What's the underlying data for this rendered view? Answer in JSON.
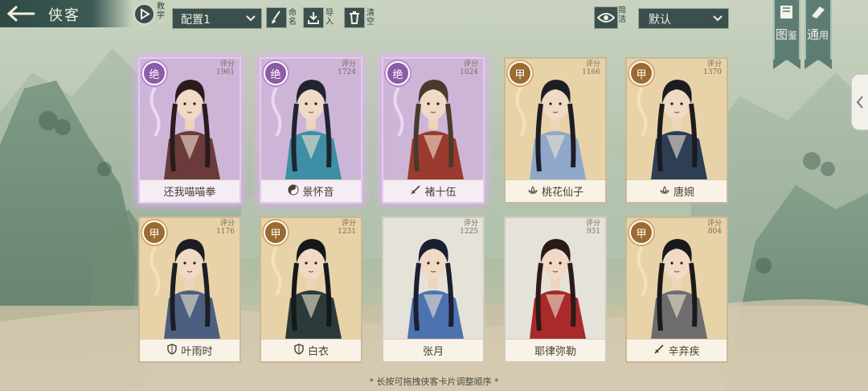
{
  "header": {
    "title": "侠客",
    "tutorial_label": "教学",
    "config_value": "配置1",
    "rename_label": "命名",
    "import_label": "导入",
    "clear_label": "清空",
    "simple_label": "简洁",
    "sort_value": "默认"
  },
  "right_banners": [
    {
      "label_big": "图",
      "label_small": "鉴"
    },
    {
      "label_big": "通",
      "label_small": "用"
    }
  ],
  "score_label": "评分",
  "cards": [
    {
      "grade": "绝",
      "score": "1961",
      "name": "还我喵喵拳",
      "tier": "jue",
      "name_icon": "",
      "palette": [
        "#cdb5d8",
        "#6b3b3b",
        "#2a1c1c"
      ]
    },
    {
      "grade": "绝",
      "score": "1724",
      "name": "景怀音",
      "tier": "jue",
      "name_icon": "yin-yang-icon",
      "palette": [
        "#cdb5d8",
        "#3e8fa5",
        "#1e2530"
      ]
    },
    {
      "grade": "绝",
      "score": "1024",
      "name": "褚十伍",
      "tier": "jue",
      "name_icon": "sword-icon",
      "palette": [
        "#cdb5d8",
        "#9b3a2e",
        "#4a3a2a"
      ]
    },
    {
      "grade": "甲",
      "score": "1166",
      "name": "桃花仙子",
      "tier": "jia",
      "name_icon": "lotus-icon",
      "palette": [
        "#e8d3a8",
        "#8fa8c9",
        "#1d1d24"
      ]
    },
    {
      "grade": "甲",
      "score": "1370",
      "name": "唐婉",
      "tier": "jia",
      "name_icon": "lotus-icon",
      "palette": [
        "#e8d3a8",
        "#2d3e55",
        "#1b1b20"
      ]
    },
    {
      "grade": "甲",
      "score": "1176",
      "name": "叶雨时",
      "tier": "jia",
      "name_icon": "shield-icon",
      "palette": [
        "#e8d3a8",
        "#4d5f80",
        "#1d1d24"
      ]
    },
    {
      "grade": "甲",
      "score": "1231",
      "name": "白衣",
      "tier": "jia",
      "name_icon": "shield-icon",
      "palette": [
        "#e8d3a8",
        "#2c3a3a",
        "#15181a"
      ]
    },
    {
      "grade": "",
      "score": "1225",
      "name": "张月",
      "tier": "plain",
      "name_icon": "",
      "palette": [
        "#e5e2da",
        "#4d72b0",
        "#1b2030"
      ]
    },
    {
      "grade": "",
      "score": "931",
      "name": "耶律弥勒",
      "tier": "plain",
      "name_icon": "",
      "palette": [
        "#e5e2da",
        "#a82a2a",
        "#2a1a18"
      ]
    },
    {
      "grade": "甲",
      "score": "804",
      "name": "辛弃疾",
      "tier": "jia",
      "name_icon": "sword-icon",
      "palette": [
        "#e8d3a8",
        "#6d6d70",
        "#1a1a1d"
      ]
    }
  ],
  "footer_hint": "* 长按可拖拽侠客卡片调整顺序 *",
  "colors": {
    "panel": "#3b4f4c",
    "jue_glow": "#e6aaff",
    "jia_badge": "#9a6b32",
    "jue_badge": "#8c5ca7"
  }
}
